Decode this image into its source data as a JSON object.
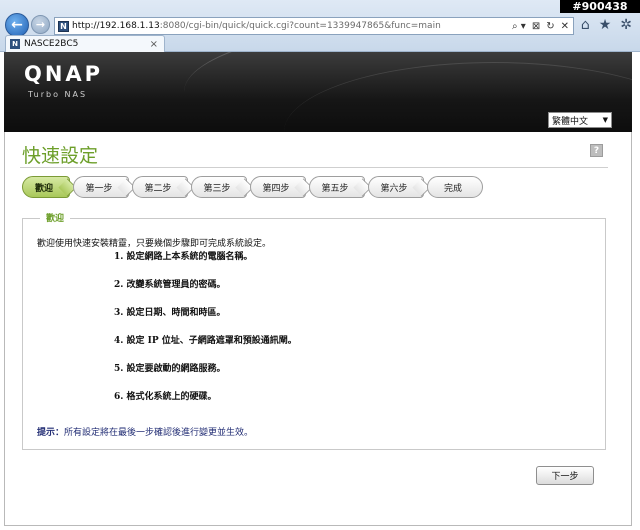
{
  "browser": {
    "url_host": "http://192.168.1.13",
    "url_rest": ":8080/cgi-bin/quick/quick.cgi?count=1339947865&func=main",
    "favicon_letter": "N",
    "tab_title": "NASCE2BC5",
    "tab_close": "×",
    "watermark": "#900438",
    "addr_tools": [
      "⌕ ▾",
      "⊠",
      "↻",
      "✕"
    ],
    "right_icons": [
      "⌂",
      "★",
      "✲"
    ]
  },
  "header": {
    "logo": "QNAP",
    "subtitle": "Turbo NAS"
  },
  "language_select": {
    "value": "繁體中文"
  },
  "page": {
    "title": "快速設定",
    "help_label": "?"
  },
  "steps": [
    {
      "label": "歡迎",
      "active": true
    },
    {
      "label": "第一步",
      "active": false
    },
    {
      "label": "第二步",
      "active": false
    },
    {
      "label": "第三步",
      "active": false
    },
    {
      "label": "第四步",
      "active": false
    },
    {
      "label": "第五步",
      "active": false
    },
    {
      "label": "第六步",
      "active": false
    },
    {
      "label": "完成",
      "active": false
    }
  ],
  "welcome": {
    "legend": "歡迎",
    "intro": "歡迎使用快速安裝精靈，只要幾個步驟即可完成系統設定。",
    "items": [
      "1. 設定網路上本系統的電腦名稱。",
      "2. 改變系統管理員的密碼。",
      "3. 設定日期、時間和時區。",
      "4. 設定 IP 位址、子網路遮罩和預設通訊閘。",
      "5. 設定要啟動的網路服務。",
      "6. 格式化系統上的硬碟。"
    ],
    "tip_label": "提示：",
    "tip_text": "所有設定將在最後一步確認後進行變更並生效。"
  },
  "next_button": "下一步",
  "colors": {
    "accent_green": "#6d9f2a",
    "tip_blue": "#222d74"
  }
}
